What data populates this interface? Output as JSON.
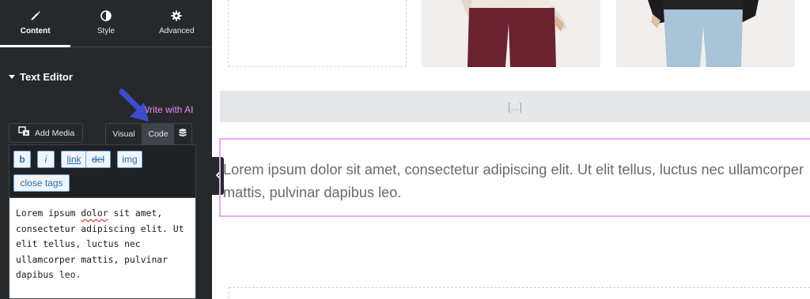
{
  "panel": {
    "tabs": [
      {
        "label": "Content",
        "icon": "pencil-icon"
      },
      {
        "label": "Style",
        "icon": "contrast-icon"
      },
      {
        "label": "Advanced",
        "icon": "gear-icon"
      }
    ],
    "active_tab": "Content",
    "section_title": "Text Editor",
    "ai_link": "Write with AI",
    "add_media_label": "Add Media",
    "editor_modes": [
      "Visual",
      "Code"
    ],
    "active_mode": "Code",
    "quicktags": [
      "b",
      "i",
      "link",
      "del",
      "img",
      "close tags"
    ],
    "code_text_before": "Lorem ipsum ",
    "code_text_misspelled": "dolor",
    "code_text_after": " sit amet, consectetur adipiscing elit. Ut elit tellus, luctus nec ullamcorper mattis, pulvinar dapibus leo."
  },
  "canvas": {
    "shortcode_placeholder": "[...]",
    "text_widget_content": "Lorem ipsum dolor sit amet, consectetur adipiscing elit. Ut elit tellus, luctus nec ullamcorper mattis, pulvinar dapibus leo."
  },
  "colors": {
    "panel_bg": "#26292c",
    "ai_accent": "#e589f5",
    "selected_border": "#e9a8f5",
    "arrow": "#3b4ccf",
    "quicktag_text": "#2271b1"
  }
}
